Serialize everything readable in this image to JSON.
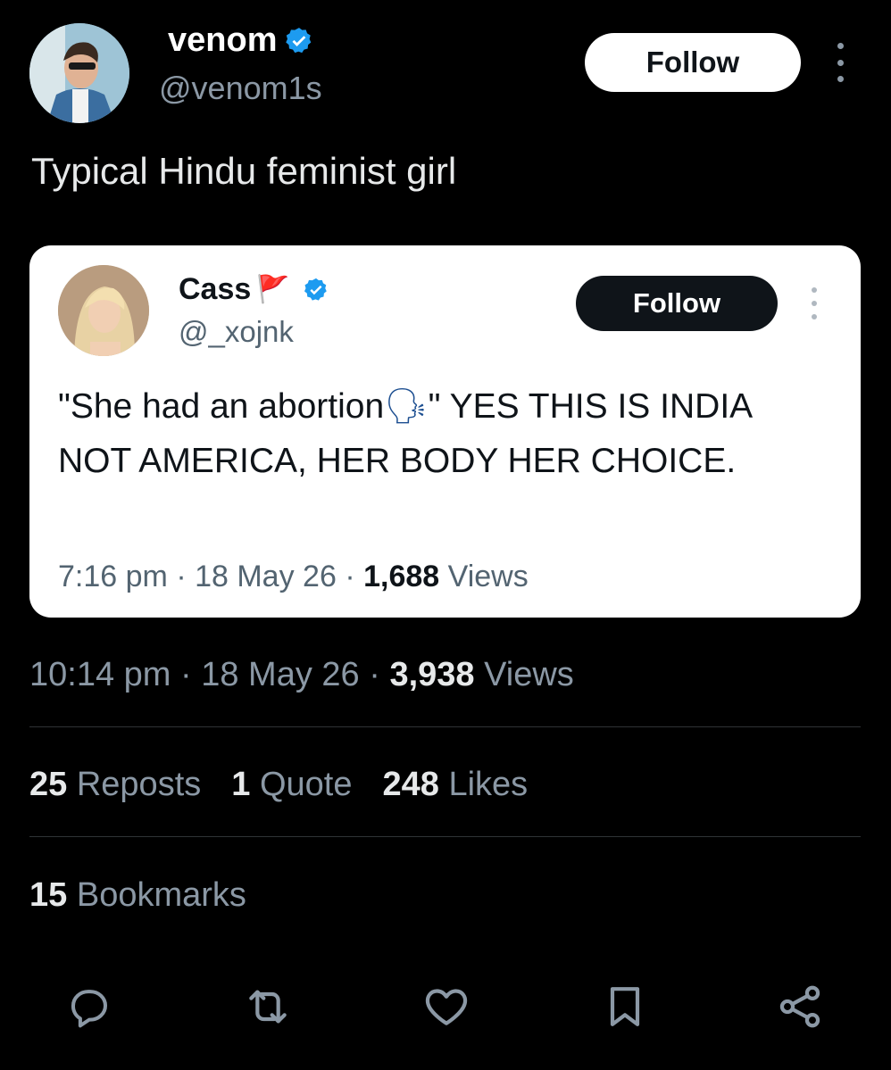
{
  "author": {
    "display_name": "venom",
    "handle": "@venom1s",
    "follow_label": "Follow"
  },
  "tweet_text": "Typical Hindu feminist girl",
  "quoted": {
    "display_name": "Cass",
    "name_emoji": "🚩",
    "handle": "@_xojnk",
    "follow_label": "Follow",
    "text_part1": "\"She had an abortion",
    "text_emoji": "🗣",
    "text_part2": "\" YES THIS IS INDIA NOT AMERICA, HER BODY HER CHOICE.",
    "time": "7:16 pm",
    "date": "18 May 26",
    "views_count": "1,688",
    "views_label": "Views"
  },
  "meta": {
    "time": "10:14 pm",
    "date": "18 May 26",
    "views_count": "3,938",
    "views_label": "Views",
    "separator": "·"
  },
  "stats": {
    "reposts_count": "25",
    "reposts_label": "Reposts",
    "quotes_count": "1",
    "quotes_label": "Quote",
    "likes_count": "248",
    "likes_label": "Likes",
    "bookmarks_count": "15",
    "bookmarks_label": "Bookmarks"
  },
  "actions": [
    "reply-icon",
    "repost-icon",
    "like-icon",
    "bookmark-icon",
    "share-icon"
  ],
  "colors": {
    "verified": "#1d9bf0",
    "background": "#000000",
    "muted": "#8b98a5"
  }
}
